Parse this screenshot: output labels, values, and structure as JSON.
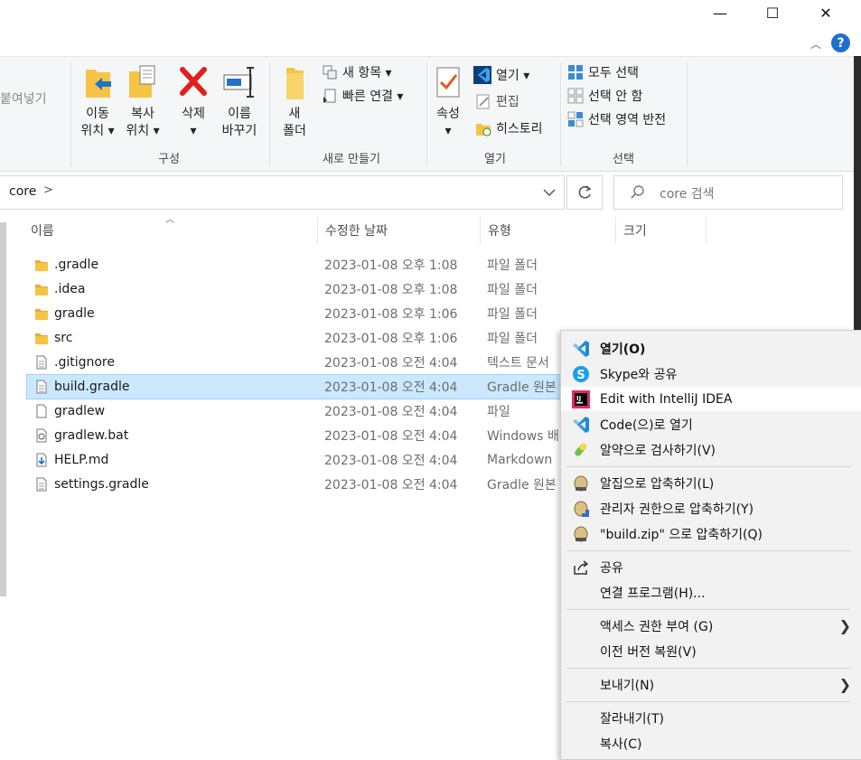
{
  "window": {
    "minimize": "—",
    "maximize": "☐",
    "close": "✕",
    "help": "?"
  },
  "ribbon": {
    "clipboard": {
      "paste_label": "붙여넣기"
    },
    "organize": {
      "group_label": "구성",
      "move_to": [
        "이동",
        "위치 ▾"
      ],
      "copy_to": [
        "복사",
        "위치 ▾"
      ],
      "delete": [
        "삭제",
        "▾"
      ],
      "rename": [
        "이름",
        "바꾸기"
      ]
    },
    "new": {
      "group_label": "새로 만들기",
      "new_folder": [
        "새",
        "폴더"
      ],
      "new_item": "새 항목 ▾",
      "easy_access": "빠른 연결 ▾"
    },
    "open": {
      "group_label": "열기",
      "properties": [
        "속성",
        "▾"
      ],
      "open": "열기 ▾",
      "edit": "편집",
      "history": "히스토리"
    },
    "select": {
      "group_label": "선택",
      "select_all": "모두 선택",
      "select_none": "선택 안 함",
      "invert": "선택 영역 반전"
    }
  },
  "address": {
    "crumb": "core",
    "sep": ">",
    "search_placeholder": "core 검색"
  },
  "columns": {
    "name": "이름",
    "date": "수정한 날짜",
    "type": "유형",
    "size": "크기"
  },
  "files": [
    {
      "name": ".gradle",
      "date": "2023-01-08 오후 1:08",
      "type": "파일 폴더",
      "kind": "folder"
    },
    {
      "name": ".idea",
      "date": "2023-01-08 오후 1:08",
      "type": "파일 폴더",
      "kind": "folder"
    },
    {
      "name": "gradle",
      "date": "2023-01-08 오후 1:06",
      "type": "파일 폴더",
      "kind": "folder"
    },
    {
      "name": "src",
      "date": "2023-01-08 오후 1:06",
      "type": "파일 폴더",
      "kind": "folder"
    },
    {
      "name": ".gitignore",
      "date": "2023-01-08 오전 4:04",
      "type": "텍스트 문서",
      "kind": "text"
    },
    {
      "name": "build.gradle",
      "date": "2023-01-08 오전 4:04",
      "type": "Gradle 원본",
      "kind": "text",
      "selected": true
    },
    {
      "name": "gradlew",
      "date": "2023-01-08 오전 4:04",
      "type": "파일",
      "kind": "blank"
    },
    {
      "name": "gradlew.bat",
      "date": "2023-01-08 오전 4:04",
      "type": "Windows 배",
      "kind": "bat"
    },
    {
      "name": "HELP.md",
      "date": "2023-01-08 오전 4:04",
      "type": "Markdown",
      "kind": "md"
    },
    {
      "name": "settings.gradle",
      "date": "2023-01-08 오전 4:04",
      "type": "Gradle 원본",
      "kind": "text"
    }
  ],
  "context_menu": [
    {
      "label": "열기(O)",
      "icon": "vscode-icon",
      "bold": true
    },
    {
      "label": "Skype와 공유",
      "icon": "skype-icon"
    },
    {
      "label": "Edit with IntelliJ IDEA",
      "icon": "intellij-icon",
      "highlight": true
    },
    {
      "label": "Code(으)로 열기",
      "icon": "vscode-icon"
    },
    {
      "label": "알약으로 검사하기(V)",
      "icon": "alyac-icon"
    },
    {
      "sep": true
    },
    {
      "label": "알집으로 압축하기(L)",
      "icon": "alzip-icon"
    },
    {
      "label": "관리자 권한으로 압축하기(Y)",
      "icon": "alzip-admin-icon"
    },
    {
      "label": "\"build.zip\" 으로 압축하기(Q)",
      "icon": "alzip-icon"
    },
    {
      "sep": true
    },
    {
      "label": "공유",
      "icon": "share-icon"
    },
    {
      "label": "연결 프로그램(H)..."
    },
    {
      "sep": true
    },
    {
      "label": "액세스 권한 부여 (G)",
      "submenu": true
    },
    {
      "label": "이전 버전 복원(V)"
    },
    {
      "sep": true
    },
    {
      "label": "보내기(N)",
      "submenu": true
    },
    {
      "sep": true
    },
    {
      "label": "잘라내기(T)"
    },
    {
      "label": "복사(C)"
    }
  ]
}
